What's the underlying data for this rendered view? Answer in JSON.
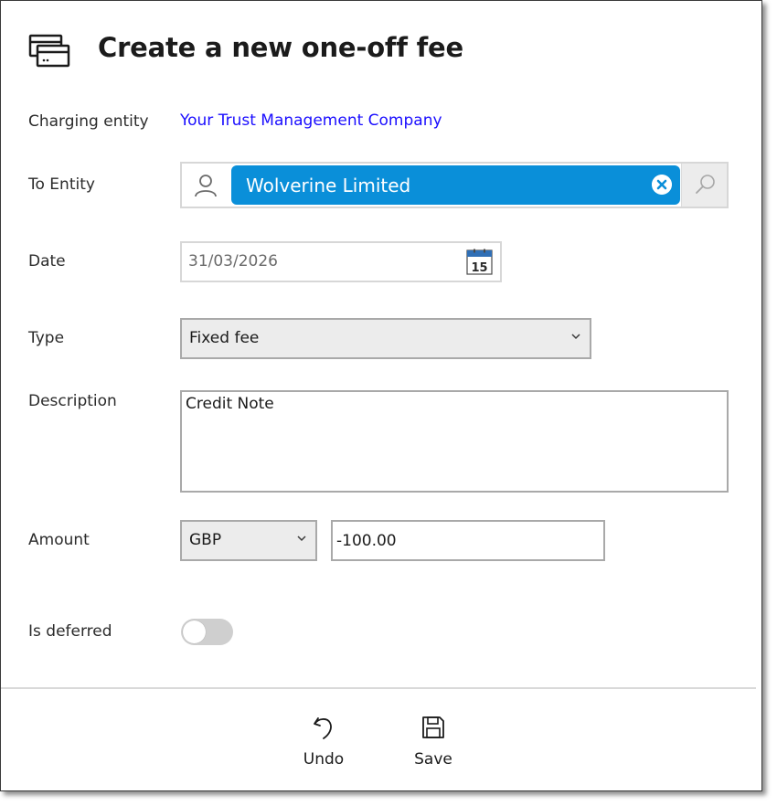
{
  "dialog": {
    "title": "Create a new one-off fee",
    "icon": "card-icon"
  },
  "form": {
    "charging_entity": {
      "label": "Charging entity",
      "value": "Your Trust Management Company",
      "color": "#1a0dff"
    },
    "to_entity": {
      "label": "To Entity",
      "value": "Wolverine Limited",
      "chip_color": "#0a8fd9"
    },
    "date": {
      "label": "Date",
      "value": "31/03/2026",
      "calendar_day": "15"
    },
    "type": {
      "label": "Type",
      "value": "Fixed fee"
    },
    "description": {
      "label": "Description",
      "value": "Credit Note"
    },
    "amount": {
      "label": "Amount",
      "currency": "GBP",
      "value": "-100.00"
    },
    "is_deferred": {
      "label": "Is deferred",
      "on": false
    }
  },
  "actions": {
    "undo_label": "Undo",
    "save_label": "Save"
  }
}
